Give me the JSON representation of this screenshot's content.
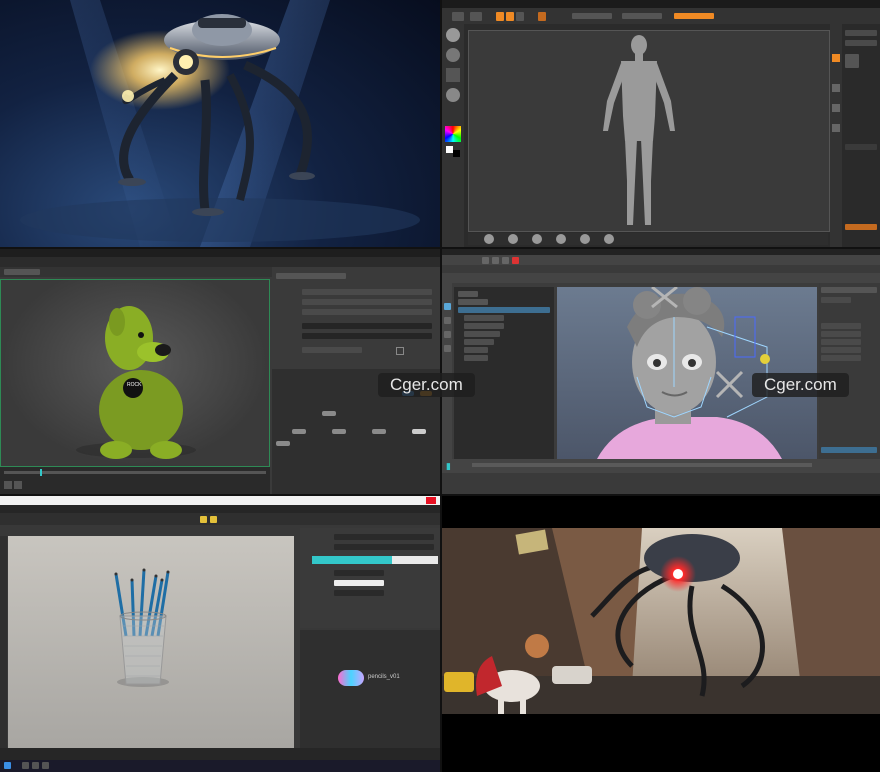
{
  "watermarks": [
    "Cger.com",
    "Cger.com"
  ],
  "pencil_scene": {
    "node_label": "pencils_v01"
  },
  "colors": {
    "maya_accent": "#f08a24",
    "houdini_cyan": "#33c7c9",
    "robot_glow": "#ffcf6a",
    "eye_red": "#ff2a2a",
    "sweater_pink": "#e7a8dc"
  },
  "icons": [
    "window-close-icon",
    "render-icon",
    "brush-icon",
    "color-picker-icon",
    "timeline-icon"
  ]
}
